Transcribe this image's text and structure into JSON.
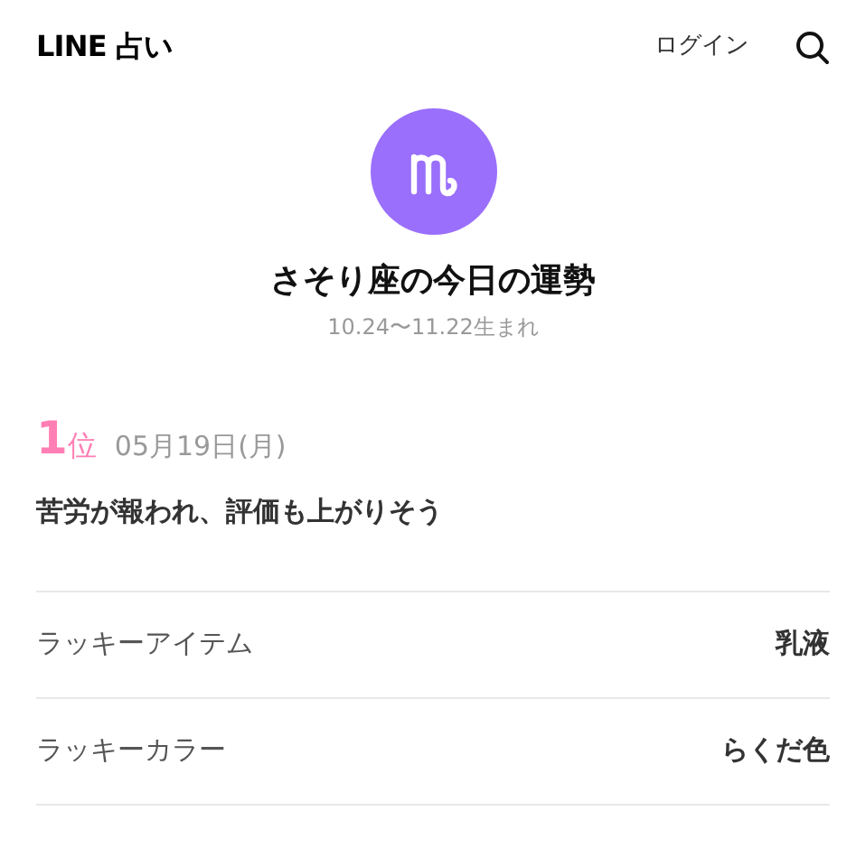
{
  "header": {
    "logo": "LINE 占い",
    "login": "ログイン"
  },
  "sign": {
    "title": "さそり座の今日の運勢",
    "dates": "10.24〜11.22生まれ"
  },
  "ranking": {
    "rank": "1",
    "rank_suffix": "位",
    "date": "05月19日(月)",
    "summary": "苦労が報われ、評価も上がりそう"
  },
  "lucky": [
    {
      "label": "ラッキーアイテム",
      "value": "乳液"
    },
    {
      "label": "ラッキーカラー",
      "value": "らくだ色"
    }
  ]
}
